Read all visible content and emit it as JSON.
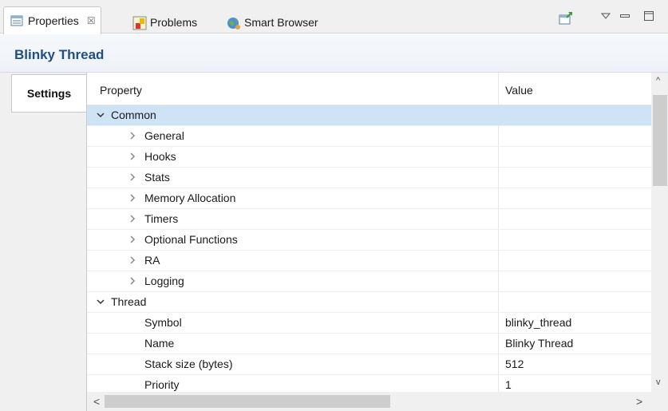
{
  "tabs": {
    "properties": {
      "label": "Properties",
      "close": "☒"
    },
    "problems": {
      "label": "Problems"
    },
    "smart_browser": {
      "label": "Smart Browser"
    }
  },
  "title": "Blinky Thread",
  "side_tabs": [
    {
      "label": "Settings"
    }
  ],
  "table": {
    "headers": {
      "property": "Property",
      "value": "Value"
    },
    "rows": [
      {
        "label": "Common",
        "value": "",
        "state": "expanded",
        "selected": true
      },
      {
        "label": "General",
        "value": "",
        "state": "collapsed"
      },
      {
        "label": "Hooks",
        "value": "",
        "state": "collapsed"
      },
      {
        "label": "Stats",
        "value": "",
        "state": "collapsed"
      },
      {
        "label": "Memory Allocation",
        "value": "",
        "state": "collapsed"
      },
      {
        "label": "Timers",
        "value": "",
        "state": "collapsed"
      },
      {
        "label": "Optional Functions",
        "value": "",
        "state": "collapsed"
      },
      {
        "label": "RA",
        "value": "",
        "state": "collapsed"
      },
      {
        "label": "Logging",
        "value": "",
        "state": "collapsed"
      },
      {
        "label": "Thread",
        "value": "",
        "state": "expanded"
      },
      {
        "label": "Symbol",
        "value": "blinky_thread",
        "state": "leaf"
      },
      {
        "label": "Name",
        "value": "Blinky Thread",
        "state": "leaf"
      },
      {
        "label": "Stack size (bytes)",
        "value": "512",
        "state": "leaf"
      },
      {
        "label": "Priority",
        "value": "1",
        "state": "leaf"
      }
    ]
  },
  "icons": {
    "properties_tab": "properties-icon",
    "problems_tab": "problems-icon",
    "smart_browser_tab": "globe-icon",
    "new_view": "pin-icon",
    "view_menu": "view-menu-icon",
    "minimize": "minimize-icon",
    "maximize": "maximize-icon"
  },
  "colors": {
    "title": "#1f4f83",
    "selection": "#cfe3f6",
    "accent": "#2f7fd0"
  }
}
